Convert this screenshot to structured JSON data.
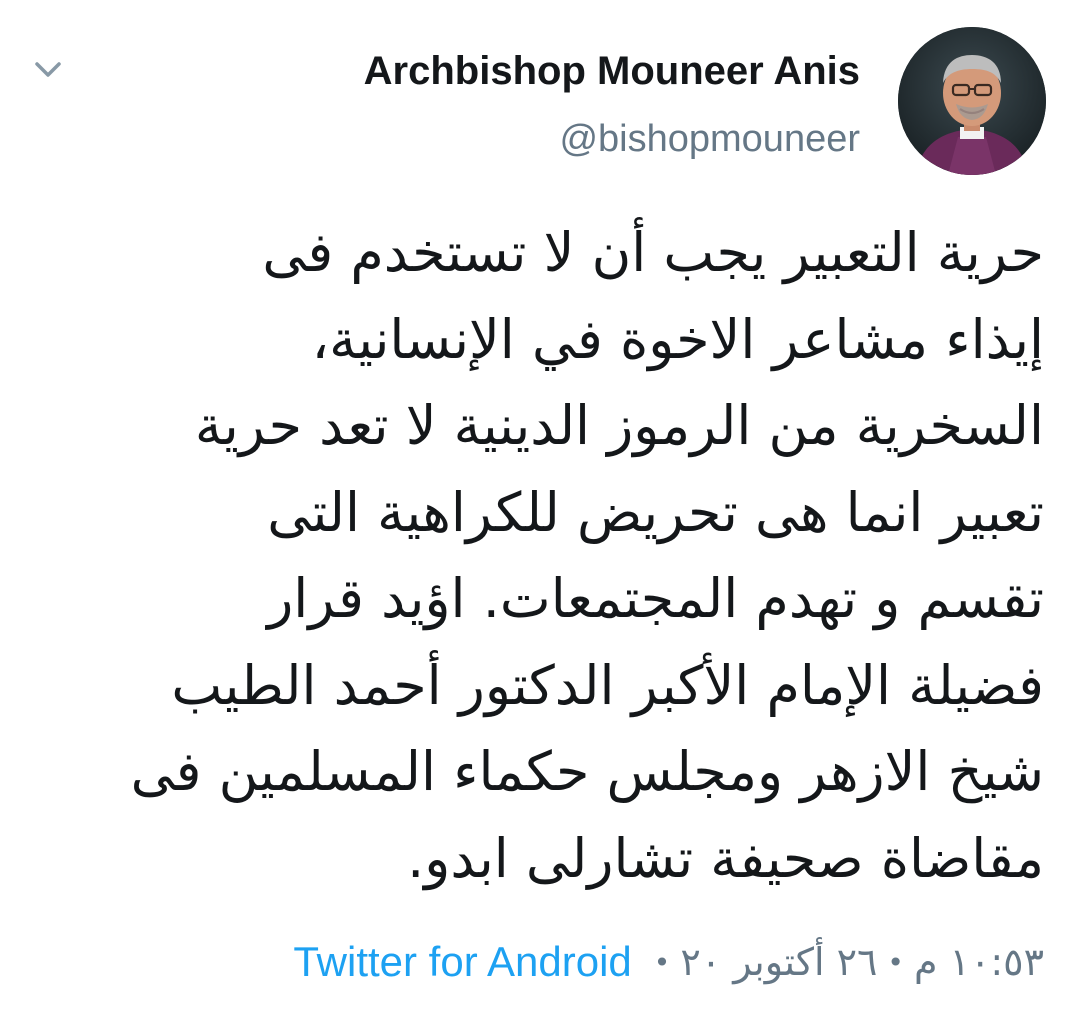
{
  "author": {
    "display_name": "Archbishop Mouneer Anis",
    "handle": "@bishopmouneer"
  },
  "tweet": {
    "lines": [
      "حرية التعبير يجب أن لا تستخدم فى",
      "إيذاء مشاعر الاخوة في الإنسانية،",
      "السخرية من الرموز الدينية لا تعد حرية",
      "تعبير انما هى تحريض للكراهية التى",
      "تقسم و تهدم المجتمعات. اؤيد قرار",
      "فضيلة الإمام الأكبر الدكتور أحمد الطيب",
      "شيخ الازهر ومجلس حكماء المسلمين  فى",
      "مقاضاة صحيفة تشارلى ابدو."
    ]
  },
  "meta": {
    "time": "١٠:٥٣ م",
    "date": "٢٦ أكتوبر ٢٠",
    "separator": "•",
    "source": "Twitter for Android"
  },
  "icons": {
    "caret": "chevron-down-icon",
    "avatar": "profile-photo"
  },
  "colors": {
    "text_primary": "#14171a",
    "text_secondary": "#657786",
    "link": "#1da1f2"
  }
}
